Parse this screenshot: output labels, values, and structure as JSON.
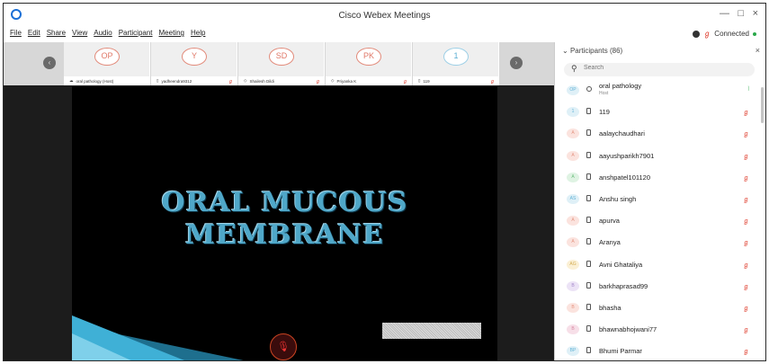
{
  "window": {
    "title": "Cisco Webex Meetings",
    "minimize": "—",
    "maximize": "□",
    "close": "×"
  },
  "menubar": {
    "items": [
      "File",
      "Edit",
      "Share",
      "View",
      "Audio",
      "Participant",
      "Meeting",
      "Help"
    ],
    "status": "Connected"
  },
  "video_strip": {
    "prev_icon": "‹",
    "next_icon": "›",
    "tiles": [
      {
        "initials": "OP",
        "name": "oral pathology (Host)"
      },
      {
        "initials": "Y",
        "name": "yadheendra9312"
      },
      {
        "initials": "SD",
        "name": "Shailesh Dildi"
      },
      {
        "initials": "PK",
        "name": "Priyanka K"
      },
      {
        "initials": "1",
        "name": "119"
      }
    ]
  },
  "shared_content": {
    "slide_title_line1": "ORAL MUCOUS",
    "slide_title_line2": "MEMBRANE",
    "mute_icon": "🎙"
  },
  "participants": {
    "header": "Participants (86)",
    "search_placeholder": "Search",
    "list": [
      {
        "initials": "OP",
        "name": "oral pathology",
        "sub": "Host",
        "host": true
      },
      {
        "initials": "1",
        "name": "119"
      },
      {
        "initials": "A",
        "name": "aalaychaudhari"
      },
      {
        "initials": "A",
        "name": "aayushparikh7901"
      },
      {
        "initials": "A",
        "name": "anshpatel101120"
      },
      {
        "initials": "AS",
        "name": "Anshu singh"
      },
      {
        "initials": "A",
        "name": "apurva"
      },
      {
        "initials": "A",
        "name": "Aranya"
      },
      {
        "initials": "AG",
        "name": "Avni Ghataliya"
      },
      {
        "initials": "B",
        "name": "barkhaprasad99"
      },
      {
        "initials": "B",
        "name": "bhasha"
      },
      {
        "initials": "B",
        "name": "bhawnabhojwani77"
      },
      {
        "initials": "BP",
        "name": "Bhumi Parmar"
      }
    ]
  }
}
